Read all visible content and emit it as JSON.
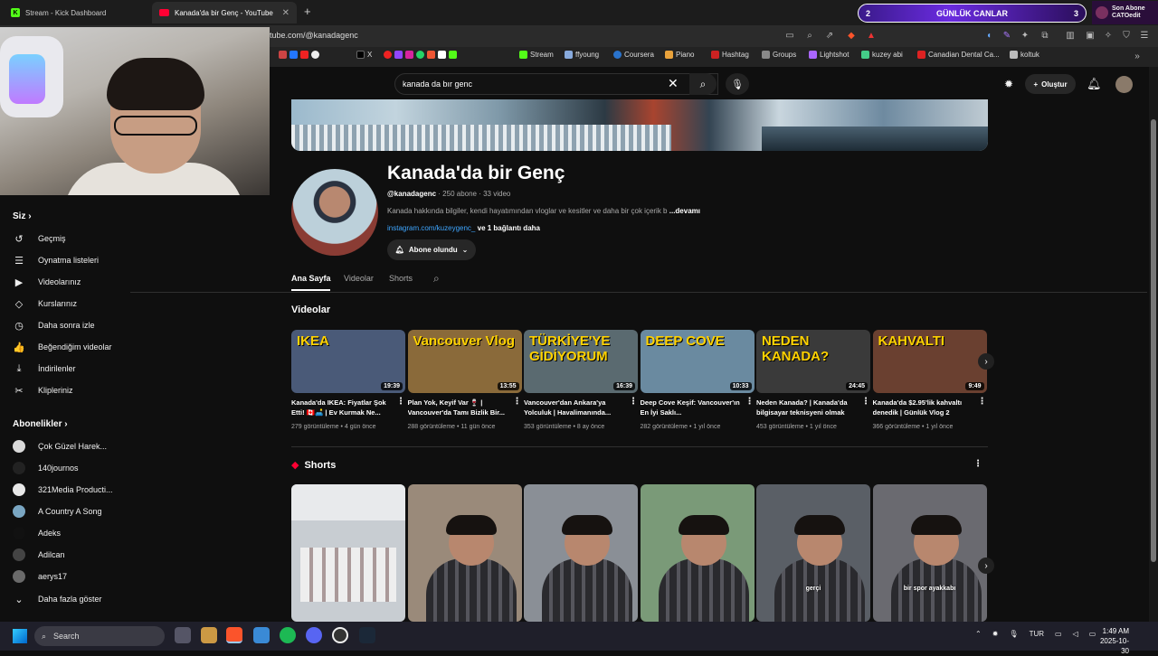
{
  "browser": {
    "tabs": [
      {
        "label": "Stream - Kick Dashboard",
        "active": false
      },
      {
        "label": "Kanada'da bir Genç - YouTube",
        "active": true
      }
    ],
    "url": "tube.com/@kanadagenc"
  },
  "overlay": {
    "counter_left": "2",
    "counter_title": "GÜNLÜK CANLAR",
    "counter_right": "3",
    "last_sub_label": "Son Abone",
    "last_sub_name": "CATOedit"
  },
  "bookmarks": [
    "X",
    "Stream",
    "ffyoung",
    "Coursera",
    "Piano",
    "Hashtag",
    "Groups",
    "Lightshot",
    "kuzey abi",
    "Canadian Dental Ca...",
    "koltuk"
  ],
  "search": {
    "value": "kanada da bır genc"
  },
  "header": {
    "create_label": "Oluştur"
  },
  "sidebar": {
    "you_heading": "Siz",
    "items": [
      {
        "label": "Geçmiş",
        "icon": "history-icon",
        "glyph": "↺"
      },
      {
        "label": "Oynatma listeleri",
        "icon": "playlists-icon",
        "glyph": "☰"
      },
      {
        "label": "Videolarınız",
        "icon": "your-videos-icon",
        "glyph": "▶"
      },
      {
        "label": "Kurslarınız",
        "icon": "courses-icon",
        "glyph": "◇"
      },
      {
        "label": "Daha sonra izle",
        "icon": "watch-later-icon",
        "glyph": "◷"
      },
      {
        "label": "Beğendiğim videolar",
        "icon": "like-icon",
        "glyph": "👍"
      },
      {
        "label": "İndirilenler",
        "icon": "download-icon",
        "glyph": "⤓"
      },
      {
        "label": "Klipleriniz",
        "icon": "clips-icon",
        "glyph": "✂"
      }
    ],
    "subs_heading": "Abonelikler",
    "subscriptions": [
      {
        "label": "Çok Güzel Harek...",
        "color": "#d9d9d9"
      },
      {
        "label": "140journos",
        "color": "#222222"
      },
      {
        "label": "321Media Producti...",
        "color": "#e8e8e8"
      },
      {
        "label": "A Country A Song",
        "color": "#7aa6c2"
      },
      {
        "label": "Adeks",
        "color": "#111111"
      },
      {
        "label": "Adilcan",
        "color": "#444444"
      },
      {
        "label": "aerys17",
        "color": "#6a6a6a"
      }
    ],
    "show_more": "Daha fazla göster"
  },
  "channel": {
    "name": "Kanada'da bir Genç",
    "handle": "@kanadagenc",
    "stats": "· 250 abone · 33 video",
    "description": "Kanada hakkında bilgiler, kendi hayatımından vloglar ve kesitler ve daha bir çok içerik b",
    "more": "...devamı",
    "link": "instagram.com/kuzeygenc_",
    "link_more": "ve 1 bağlantı daha",
    "subscribed_label": "Abone olundu"
  },
  "tabs": [
    "Ana Sayfa",
    "Videolar",
    "Shorts"
  ],
  "videos_heading": "Videolar",
  "videos": [
    {
      "title": "Kanada'da IKEA: Fiyatlar Şok Etti! 🇨🇦🛋️ | Ev Kurmak Ne...",
      "meta": "279 görüntüleme • 4 gün önce",
      "duration": "19:39",
      "thumb_text": "IKEA",
      "bg": "#4a5a78"
    },
    {
      "title": "Plan Yok, Keyif Var 🍷 | Vancouver'da Tamı Bizlik Bir...",
      "meta": "288 görüntüleme • 11 gün önce",
      "duration": "13:55",
      "thumb_text": "Vancouver Vlog",
      "bg": "#8a6a3a"
    },
    {
      "title": "Vancouver'dan Ankara'ya Yolculuk | Havalimanında...",
      "meta": "353 görüntüleme • 8 ay önce",
      "duration": "16:39",
      "thumb_text": "TÜRKİYE'YE GİDİYORUM",
      "bg": "#5a6a70"
    },
    {
      "title": "Deep Cove Keşif: Vancouver'ın En İyi Saklı...",
      "meta": "282 görüntüleme • 1 yıl önce",
      "duration": "10:33",
      "thumb_text": "DEEP COVE",
      "bg": "#6a8aa0"
    },
    {
      "title": "Neden Kanada? | Kanada'da bilgisayar teknisyeni olmak",
      "meta": "453 görüntüleme • 1 yıl önce",
      "duration": "24:45",
      "thumb_text": "NEDEN KANADA?",
      "bg": "#3a3a3a"
    },
    {
      "title": "Kanada'da $2.95'lik kahvaltı denedik | Günlük Vlog 2",
      "meta": "366 görüntüleme • 1 yıl önce",
      "duration": "9:49",
      "thumb_text": "KAHVALTI",
      "bg": "#6a4030"
    }
  ],
  "shorts_heading": "Shorts",
  "shorts": [
    {
      "caption": "",
      "bg": "#c8cdd2"
    },
    {
      "caption": "",
      "bg": "#9a8a7a"
    },
    {
      "caption": "",
      "bg": "#8a8f96"
    },
    {
      "caption": "",
      "bg": "#7a9a78"
    },
    {
      "caption": "gerçi",
      "bg": "#5a5f66"
    },
    {
      "caption": "bir spor ayakkabı",
      "bg": "#6a6a70"
    }
  ],
  "taskbar": {
    "search_placeholder": "Search",
    "lang": "TUR",
    "time": "1:49 AM",
    "date": "2025-10-30"
  }
}
